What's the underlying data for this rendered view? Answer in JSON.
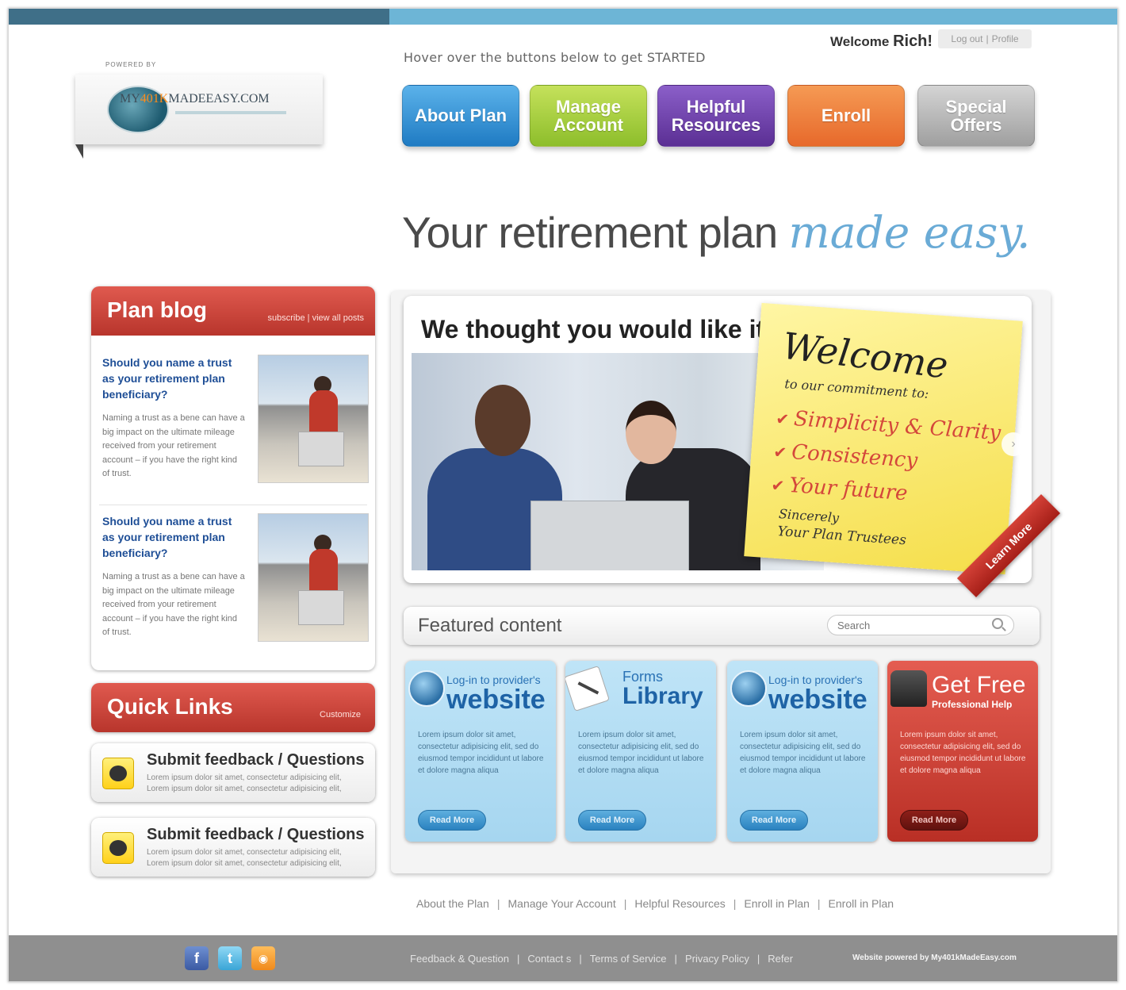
{
  "header": {
    "welcome_prefix": "Welcome",
    "user_name": "Rich!",
    "logout": "Log out",
    "profile": "Profile",
    "hover_note": "Hover over the buttons below to get STARTED"
  },
  "logo": {
    "powered_label": "POWERED BY",
    "text_prefix": "MY",
    "text_accent": "401K",
    "text_main": "MADEEASY.COM"
  },
  "nav": {
    "about": "About Plan",
    "manage": "Manage Account",
    "helpful": "Helpful Resources",
    "enroll": "Enroll",
    "special": "Special Offers"
  },
  "headline": {
    "main": "Your retirement plan ",
    "script": "made easy."
  },
  "blog": {
    "title": "Plan blog",
    "links": "subscribe | view all posts",
    "posts": [
      {
        "title": "Should you name a trust as your retirement plan beneficiary?",
        "body": "Naming a trust as a bene can have a big impact on the ultimate mileage received from your retirement account – if you have the right kind of trust."
      },
      {
        "title": "Should you name a trust as your retirement plan beneficiary?",
        "body": "Naming a trust as a bene can have a big impact on the ultimate mileage received from your retirement account – if you have the right kind of trust."
      }
    ]
  },
  "quick_links": {
    "title": "Quick Links",
    "customize": "Customize",
    "items": [
      {
        "title": "Submit feedback / Questions",
        "line1": "Lorem ipsum dolor sit amet, consectetur adipisicing elit,",
        "line2": "Lorem ipsum dolor sit amet, consectetur adipisicing elit,"
      },
      {
        "title": "Submit feedback / Questions",
        "line1": "Lorem ipsum dolor sit amet, consectetur adipisicing elit,",
        "line2": "Lorem ipsum dolor sit amet, consectetur adipisicing elit,"
      }
    ]
  },
  "hero": {
    "title": "We thought you would like it!",
    "note_welcome": "Welcome",
    "note_sub": "to our commitment to:",
    "note_items": [
      "Simplicity & Clarity",
      "Consistency",
      "Your future"
    ],
    "note_sign1": "Sincerely",
    "note_sign2": "Your Plan Trustees",
    "ribbon": "Learn More",
    "next_icon": "›"
  },
  "featured": {
    "title": "Featured content",
    "search_placeholder": "Search"
  },
  "tiles": [
    {
      "small": "Log-in to provider's",
      "big": "website",
      "text": "Lorem ipsum dolor sit amet, consectetur adipisicing elit, sed do eiusmod tempor incididunt ut labore et dolore magna aliqua",
      "button": "Read More"
    },
    {
      "small": "Forms",
      "big": "Library",
      "text": "Lorem ipsum dolor sit amet, consectetur adipisicing elit, sed do eiusmod tempor incididunt ut labore et dolore magna aliqua",
      "button": "Read More"
    },
    {
      "small": "Log-in to provider's",
      "big": "website",
      "text": "Lorem ipsum dolor sit amet, consectetur adipisicing elit, sed do eiusmod tempor incididunt ut labore et dolore magna aliqua",
      "button": "Read More"
    },
    {
      "small": "Get Free",
      "big": "Professional Help",
      "text": "Lorem ipsum dolor sit amet, consectetur adipisicing elit, sed do eiusmod tempor incididunt ut labore et dolore magna aliqua",
      "button": "Read More"
    }
  ],
  "footer_links": [
    "About the Plan",
    "Manage Your Account",
    "Helpful Resources",
    "Enroll in Plan",
    "Enroll in Plan"
  ],
  "bottom": {
    "links": [
      "Feedback & Question",
      "Contact s",
      "Terms of Service",
      "Privacy Policy",
      "Refer"
    ],
    "powered_by": "Website powered by My401kMadeEasy.com",
    "icons": [
      "facebook-icon",
      "twitter-icon",
      "rss-icon"
    ]
  },
  "colors": {
    "accent_blue": "#6db5d6",
    "accent_dark": "#3f6f88",
    "red": "#c9463c",
    "footer_gray": "#8f8f8f"
  }
}
